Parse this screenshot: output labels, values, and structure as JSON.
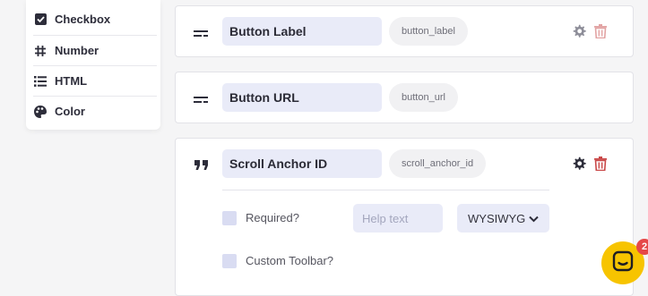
{
  "palette": {
    "items": [
      {
        "label": "Checkbox",
        "icon": "checkbox-icon"
      },
      {
        "label": "Number",
        "icon": "hash-icon"
      },
      {
        "label": "HTML",
        "icon": "list-icon"
      },
      {
        "label": "Color",
        "icon": "palette-icon"
      }
    ]
  },
  "fields": [
    {
      "name": "Button Label",
      "key": "button_label",
      "icon": "text-handle-icon"
    },
    {
      "name": "Button URL",
      "key": "button_url",
      "icon": "text-handle-icon"
    },
    {
      "name": "Scroll Anchor ID",
      "key": "scroll_anchor_id",
      "icon": "quote-icon"
    }
  ],
  "options": {
    "required_label": "Required?",
    "help_placeholder": "Help text",
    "editor_select": "WYSIWYG",
    "custom_toolbar_label": "Custom Toolbar?"
  },
  "chat": {
    "badge_count": "2"
  },
  "colors": {
    "accent_input": "#e9ebf8",
    "trash": "#c94848",
    "chat": "#f7c400"
  }
}
